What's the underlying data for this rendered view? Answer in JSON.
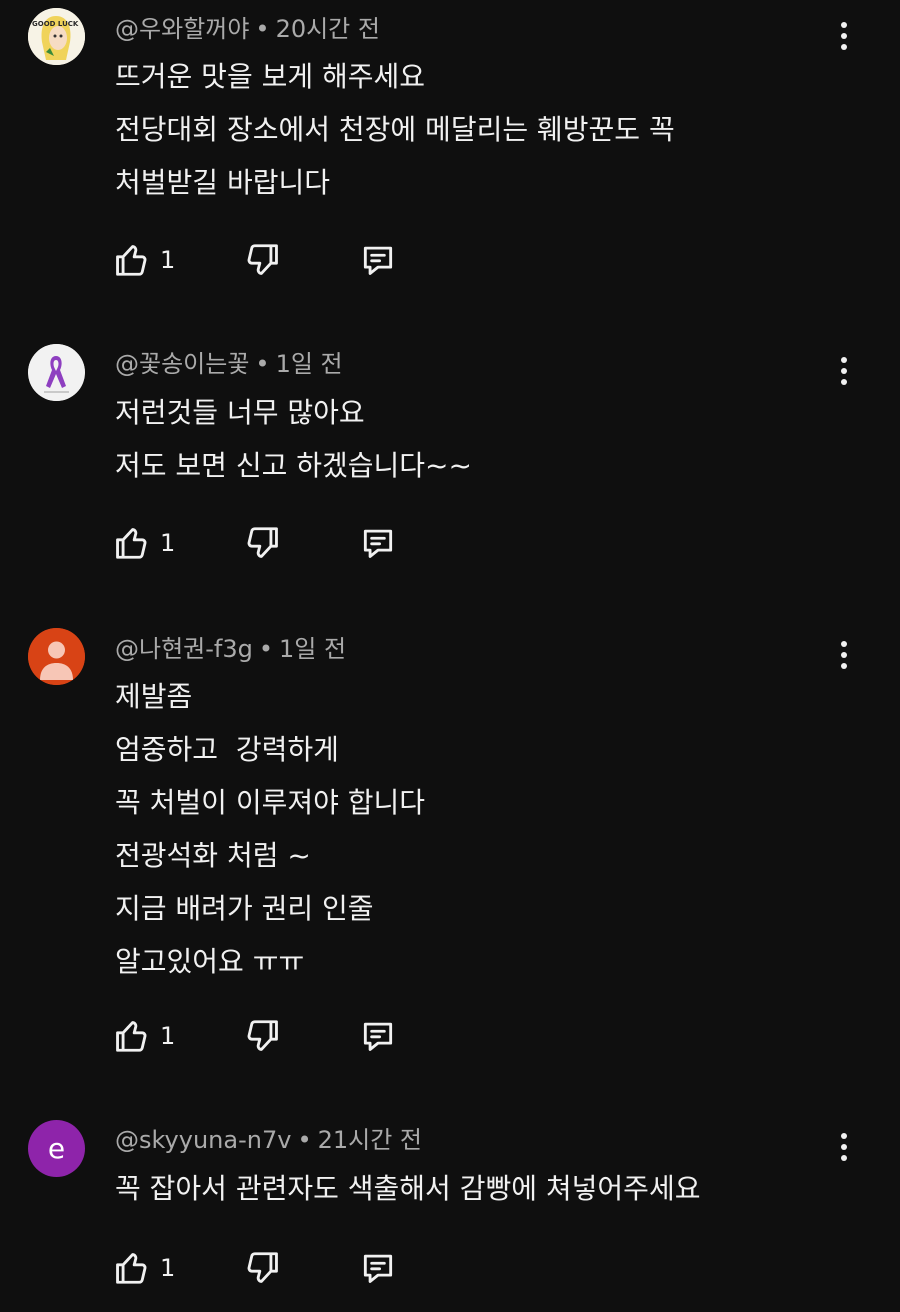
{
  "comments": [
    {
      "author": "@우와할꺼야",
      "time": "20시간 전",
      "lines": [
        "뜨거운 맛을 보게 해주세요",
        "전당대회 장소에서 천장에 메달리는 훼방꾼도 꼭",
        "처벌받길 바랍니다"
      ],
      "likes": "1",
      "avatar_text": "GOOD LUCK"
    },
    {
      "author": "@꽃송이는꽃",
      "time": "1일 전",
      "lines": [
        "저런것들 너무 많아요",
        "저도 보면 신고 하겠습니다~~"
      ],
      "likes": "1",
      "avatar_color": "#f2f2f2"
    },
    {
      "author": "@나현권-f3g",
      "time": "1일 전",
      "lines": [
        "제발좀",
        "엄중하고  강력하게",
        "꼭 처벌이 이루져야 합니다",
        "전광석화 처럼 ~",
        "지금 배려가 권리 인줄",
        "알고있어요 ㅠㅠ"
      ],
      "likes": "1",
      "avatar_color": "#d84315"
    },
    {
      "author": "@skyyuna-n7v",
      "time": "21시간 전",
      "lines": [
        "꼭 잡아서 관련자도 색출해서 감빵에 쳐넣어주세요"
      ],
      "likes": "1",
      "avatar_letter": "e",
      "avatar_color": "#8e24aa"
    }
  ],
  "icons": {
    "like": "thumbs-up-icon",
    "dislike": "thumbs-down-icon",
    "reply": "reply-icon",
    "menu": "more-vertical-icon"
  },
  "colors": {
    "background": "#0f0f0f",
    "meta_text": "#aaaaaa",
    "body_text": "#f1f1f1"
  }
}
